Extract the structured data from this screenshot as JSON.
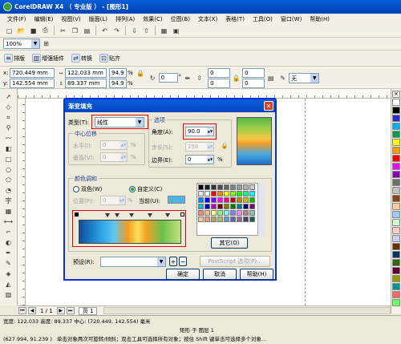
{
  "window": {
    "title": "CorelDRAW X4 （ 专业版 ） - [图形1]"
  },
  "menu": [
    "文件(F)",
    "编辑(E)",
    "视图(V)",
    "版面(L)",
    "排列(A)",
    "效果(C)",
    "位图(B)",
    "文本(X)",
    "表格(T)",
    "工具(O)",
    "窗口(W)",
    "帮助(H)"
  ],
  "toolbar": {
    "zoom": "100%"
  },
  "custom_toolbar": {
    "items": [
      "排版",
      "增强插件",
      "转换",
      "贴齐"
    ]
  },
  "property_bar": {
    "x": "720.449 mm",
    "y": "142.554 mm",
    "w": "122.033 mm",
    "h": "89.337 mm",
    "scale_x": "94.9",
    "scale_y": "94.9",
    "pct": "%",
    "angle": "0",
    "angle_unit": "°",
    "outline": "无",
    "extra": [
      "0",
      "0",
      "0",
      "0"
    ],
    "extra_unit": "%"
  },
  "dialog": {
    "title": "渐变填充",
    "type_label": "类型(T):",
    "type_value": "线性",
    "center_group": "中心位移",
    "horizontal_label": "水平(I):",
    "horizontal_value": "0",
    "vertical_label": "垂直(V):",
    "vertical_value": "0",
    "options_group": "选项",
    "angle_label": "角度(A):",
    "angle_value": "90.0",
    "steps_label": "步长(S):",
    "steps_value": "256",
    "edge_label": "边界(E):",
    "edge_value": "0",
    "pct": "%",
    "blend_group": "颜色调和",
    "two_color": "双色(W)",
    "custom": "自定义(C)",
    "position_label": "位置(P):",
    "position_value": "0",
    "current_label": "当前(U):",
    "current_color": "#4fb2e8",
    "others": "其它(O)",
    "preset_label": "预设(R):",
    "preset_value": "",
    "postscript": "PostScript 选项(P)...",
    "ok": "确定",
    "cancel": "取消",
    "help": "帮助(H)"
  },
  "preset_colors": [
    "#000000",
    "#1a1a1a",
    "#333333",
    "#4d4d4d",
    "#666666",
    "#808080",
    "#999999",
    "#b3b3b3",
    "#cccccc",
    "#e6e6e6",
    "#ffffff",
    "#ff0000",
    "#ff8000",
    "#ffff00",
    "#80ff00",
    "#00ff00",
    "#00ff80",
    "#00ffff",
    "#0080ff",
    "#0000ff",
    "#8000ff",
    "#ff00ff",
    "#ff0080",
    "#c00000",
    "#c08000",
    "#c0c000",
    "#00c000",
    "#00c0c0",
    "#0000c0",
    "#c000c0",
    "#800000",
    "#808000",
    "#008000",
    "#008080",
    "#000080",
    "#800080",
    "#ff8080",
    "#ffc080",
    "#ffff80",
    "#80ff80",
    "#80ffff",
    "#8080ff",
    "#ff80ff",
    "#c08080",
    "#80c0c0",
    "#f5c6a0",
    "#e0a080",
    "#c0a060",
    "#a0c060",
    "#60a0c0",
    "#6060c0",
    "#a060a0",
    "#404060",
    "#206040"
  ],
  "palette": [
    "#ffffff",
    "#000000",
    "#2b2bcc",
    "#00b0f0",
    "#00a050",
    "#ffff00",
    "#ff9900",
    "#ff0000",
    "#ff00ff",
    "#8800aa",
    "#6e6e6e",
    "#c0c0c0",
    "#8b4513",
    "#ffcc99",
    "#99ccff",
    "#ccffcc",
    "#ffcccc",
    "#ccccff",
    "#663300",
    "#003366",
    "#336600",
    "#660033",
    "#999900",
    "#009999",
    "#ff6666",
    "#66ff66"
  ],
  "page_nav": {
    "page": "1 / 1",
    "tab": "页 1"
  },
  "status": {
    "line1": "宽度: 122.033 高度: 89.337 中心: (720.449, 142.554) 毫米",
    "line1_right": "矩形 于 图层 1",
    "line2_left": "(627.994, 91.239 )",
    "line2": "单击对象两次可旋转/倾斜；双击工具可选择所有对象；按住 Shift 键单击可选择多个对象..."
  }
}
